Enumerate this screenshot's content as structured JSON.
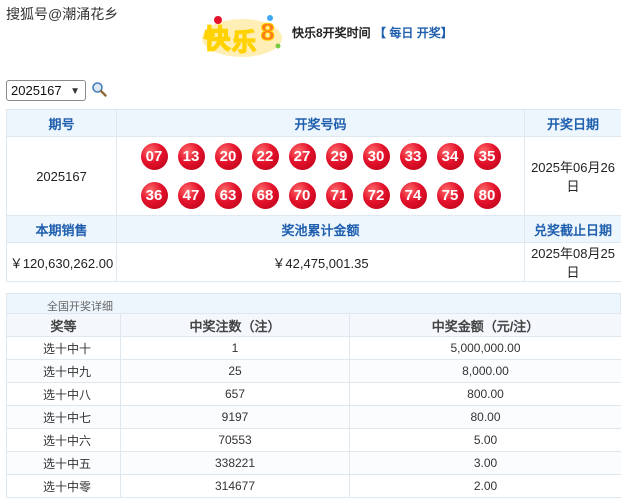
{
  "watermark": "搜狐号@潮涌花乡",
  "header": {
    "logo_text": "快乐8",
    "draw_time_label": "快乐8开奖时间",
    "draw_time_value": "【 每日 开奖】"
  },
  "selector": {
    "selected": "2025167"
  },
  "summary": {
    "headers": {
      "issue": "期号",
      "numbers": "开奖号码",
      "date": "开奖日期"
    },
    "issue": "2025167",
    "numbers": [
      "07",
      "13",
      "20",
      "22",
      "27",
      "29",
      "30",
      "33",
      "34",
      "35",
      "36",
      "47",
      "63",
      "68",
      "70",
      "71",
      "72",
      "74",
      "75",
      "80"
    ],
    "date": "2025年06月26日",
    "headers2": {
      "sales": "本期销售",
      "pool": "奖池累计金额",
      "deadline": "兑奖截止日期"
    },
    "sales": "￥120,630,262.00",
    "pool": "￥42,475,001.35",
    "deadline": "2025年08月25日"
  },
  "colors": {
    "ball": "#e4122b",
    "header_text": "#1f5fae",
    "header_bg": "#eef6fd"
  },
  "detail": {
    "caption": "全国开奖详细",
    "columns": [
      "奖等",
      "中奖注数（注）",
      "中奖金额（元/注）"
    ],
    "rows": [
      [
        "选十中十",
        "1",
        "5,000,000.00"
      ],
      [
        "选十中九",
        "25",
        "8,000.00"
      ],
      [
        "选十中八",
        "657",
        "800.00"
      ],
      [
        "选十中七",
        "9197",
        "80.00"
      ],
      [
        "选十中六",
        "70553",
        "5.00"
      ],
      [
        "选十中五",
        "338221",
        "3.00"
      ],
      [
        "选十中零",
        "314677",
        "2.00"
      ]
    ]
  }
}
